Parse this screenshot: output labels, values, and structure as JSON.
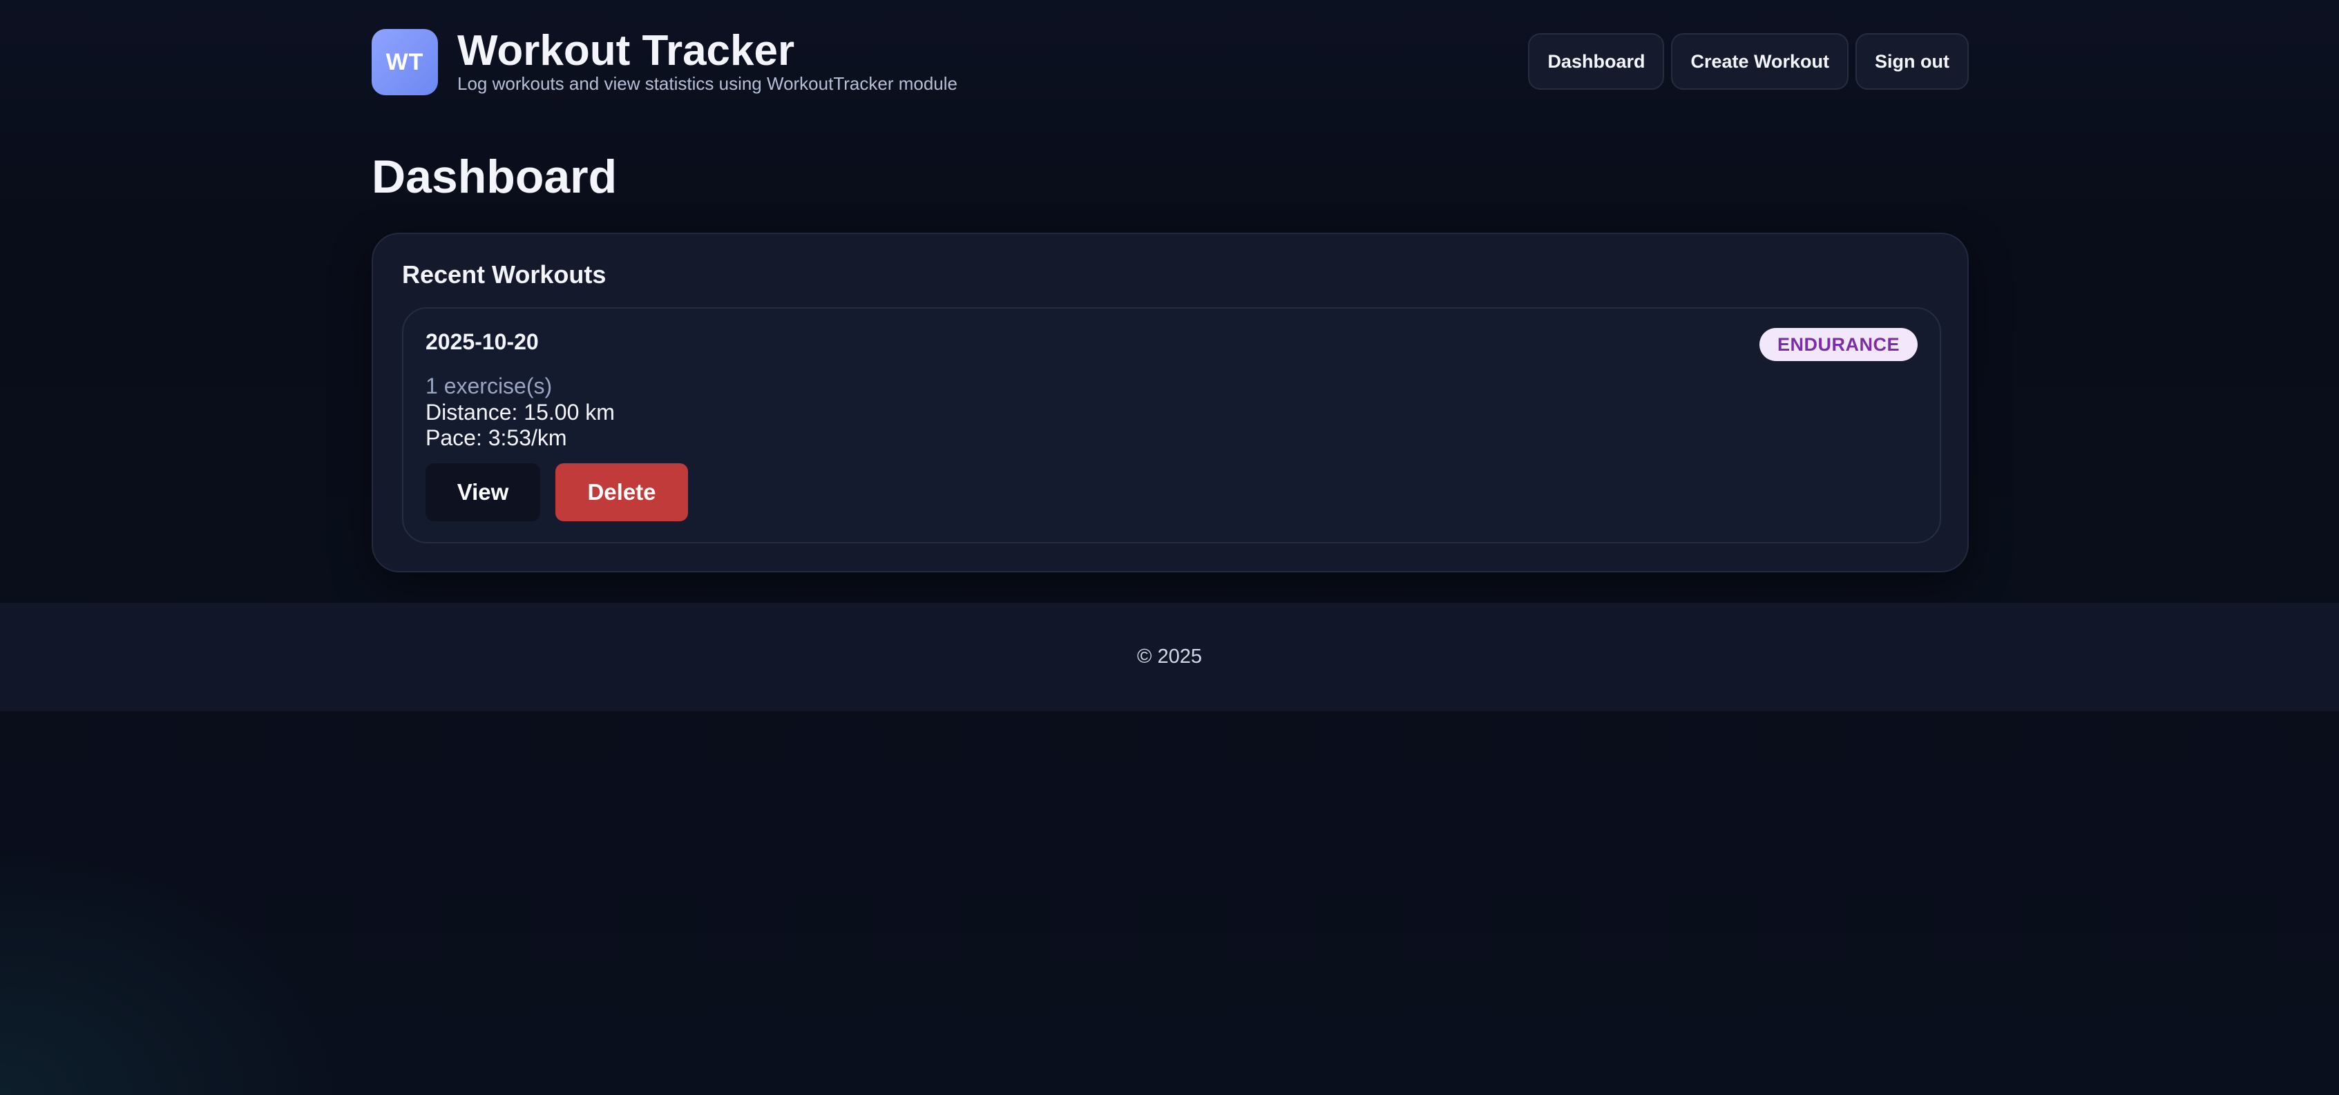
{
  "app": {
    "logo_text": "WT",
    "title": "Workout Tracker",
    "subtitle": "Log workouts and view statistics using WorkoutTracker module"
  },
  "nav": {
    "dashboard": "Dashboard",
    "create_workout": "Create Workout",
    "sign_out": "Sign out"
  },
  "page": {
    "title": "Dashboard"
  },
  "recent": {
    "title": "Recent Workouts",
    "workouts": [
      {
        "date": "2025-10-20",
        "type_badge": "ENDURANCE",
        "exercises": "1 exercise(s)",
        "distance": "Distance: 15.00 km",
        "pace": "Pace: 3:53/km",
        "view_label": "View",
        "delete_label": "Delete"
      }
    ]
  },
  "footer": {
    "text": "© 2025"
  },
  "colors": {
    "background": "#0a0f1d",
    "logo_gradient_start": "#8fa3ff",
    "logo_gradient_end": "#6d88f2",
    "badge_background": "#f2e7fb",
    "badge_text": "#7a2ea8",
    "delete_button": "#c23b3b",
    "view_button": "#0d1120"
  }
}
